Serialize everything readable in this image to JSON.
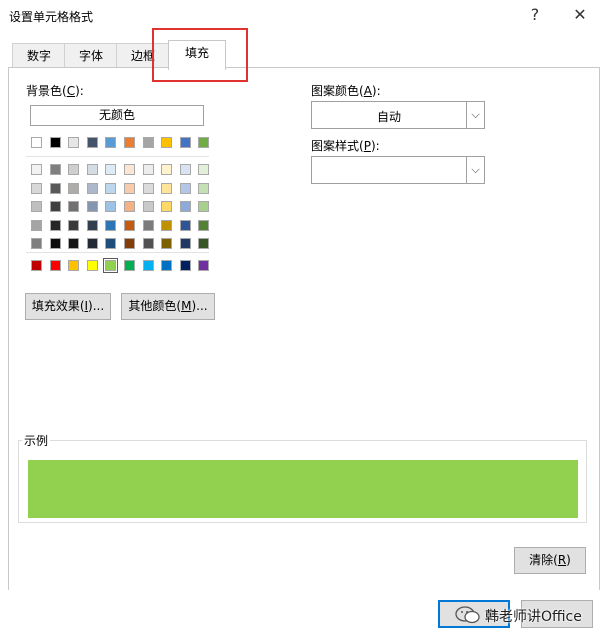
{
  "window": {
    "title": "设置单元格格式",
    "help_glyph": "?",
    "close_glyph": "✕"
  },
  "tabs": [
    {
      "label": "数字"
    },
    {
      "label": "字体"
    },
    {
      "label": "边框"
    },
    {
      "label": "填充"
    }
  ],
  "fill": {
    "background_label": "背景色(",
    "background_hotkey": "C",
    "background_label_end": "):",
    "no_color_label": "无颜色",
    "selected_color": "#92d050",
    "theme_row1": [
      "#ffffff",
      "#000000",
      "#e7e6e6",
      "#44546a",
      "#5b9bd5",
      "#ed7d31",
      "#a5a5a5",
      "#ffc000",
      "#4472c4",
      "#70ad47"
    ],
    "theme_tints": [
      [
        "#f2f2f2",
        "#7f7f7f",
        "#d0cece",
        "#d6dce4",
        "#deebf6",
        "#fbe5d5",
        "#ededed",
        "#fff2cc",
        "#d9e2f3",
        "#e2efd9"
      ],
      [
        "#d8d8d8",
        "#595959",
        "#aeabab",
        "#adb9ca",
        "#bdd7ee",
        "#f7cbac",
        "#dbdbdb",
        "#fee599",
        "#b4c6e7",
        "#c5e0b3"
      ],
      [
        "#bfbfbf",
        "#3f3f3f",
        "#757070",
        "#8496b0",
        "#9cc3e5",
        "#f4b183",
        "#c9c9c9",
        "#ffd965",
        "#8eaadb",
        "#a8d08d"
      ],
      [
        "#a5a5a5",
        "#262626",
        "#3a3838",
        "#323f4f",
        "#2e75b5",
        "#c55a11",
        "#7b7b7b",
        "#bf9000",
        "#2f5496",
        "#538135"
      ],
      [
        "#7f7f7f",
        "#0c0c0c",
        "#171616",
        "#222a35",
        "#1e4e79",
        "#843c0b",
        "#525252",
        "#7f6000",
        "#1f3864",
        "#375623"
      ]
    ],
    "standard_colors": [
      "#c00000",
      "#ff0000",
      "#ffc000",
      "#ffff00",
      "#92d050",
      "#00b050",
      "#00b0f0",
      "#0070c0",
      "#002060",
      "#7030a0"
    ],
    "fill_effects_label": "填充效果(",
    "fill_effects_hotkey": "I",
    "fill_effects_end": ")...",
    "more_colors_label": "其他颜色(",
    "more_colors_hotkey": "M",
    "more_colors_end": ")..."
  },
  "pattern": {
    "color_label": "图案颜色(",
    "color_hotkey": "A",
    "color_label_end": "):",
    "color_value": "自动",
    "style_label": "图案样式(",
    "style_hotkey": "P",
    "style_label_end": "):",
    "style_value": "",
    "arrow_glyph": "⌵"
  },
  "sample": {
    "label": "示例",
    "color": "#92d050"
  },
  "actions": {
    "clear_label": "清除(",
    "clear_hotkey": "R",
    "clear_end": ")",
    "ok_partial": "定"
  },
  "watermark": {
    "text": "韩老师讲Office"
  },
  "highlight_color": "#e0332f"
}
